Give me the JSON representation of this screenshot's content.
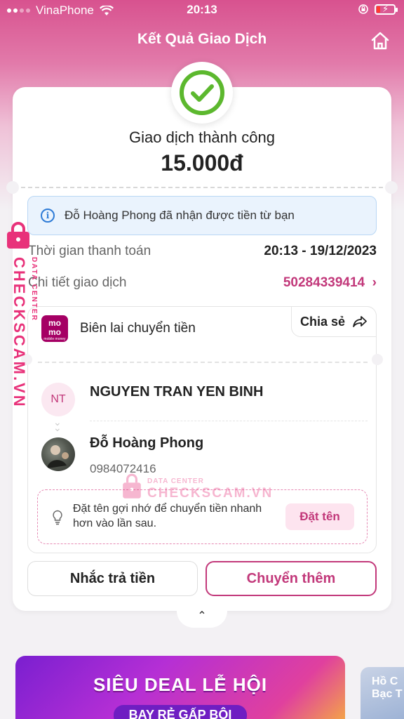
{
  "status_bar": {
    "carrier": "VinaPhone",
    "time": "20:13"
  },
  "header": {
    "title": "Kết Quả Giao Dịch"
  },
  "result": {
    "status": "Giao dịch thành công",
    "amount": "15.000đ"
  },
  "notice": {
    "text": "Đỗ Hoàng Phong đã nhận được tiền từ bạn"
  },
  "details": {
    "time_label": "Thời gian thanh toán",
    "time_value": "20:13 - 19/12/2023",
    "tx_label": "Chi tiết giao dịch",
    "tx_value": "50284339414"
  },
  "receipt": {
    "logo_text": "mo\nmo",
    "logo_sub": "mobile money",
    "title": "Biên lai chuyển tiền",
    "share_label": "Chia sẻ",
    "sender_initials": "NT",
    "sender_name": "NGUYEN TRAN YEN BINH",
    "receiver_name": "Đỗ Hoàng Phong",
    "receiver_phone": "0984072416",
    "nickname_hint": "Đặt tên gợi nhớ để chuyển tiền nhanh hơn vào lần sau.",
    "nickname_button": "Đặt tên"
  },
  "actions": {
    "remind_label": "Nhắc trả tiền",
    "transfer_more_label": "Chuyển thêm"
  },
  "banner": {
    "line1": "SIÊU DEAL LỄ HỘI",
    "line2": "BAY RẺ GẤP BỘI",
    "side_text": "Hồ C\nBạc T"
  },
  "watermark": {
    "brand": "CHECKSCAM.VN",
    "sub": "DATA CENTER"
  },
  "colors": {
    "accent": "#c2387a",
    "success": "#5cb82e",
    "info": "#2e7bd6",
    "watermark": "#e8327a"
  }
}
